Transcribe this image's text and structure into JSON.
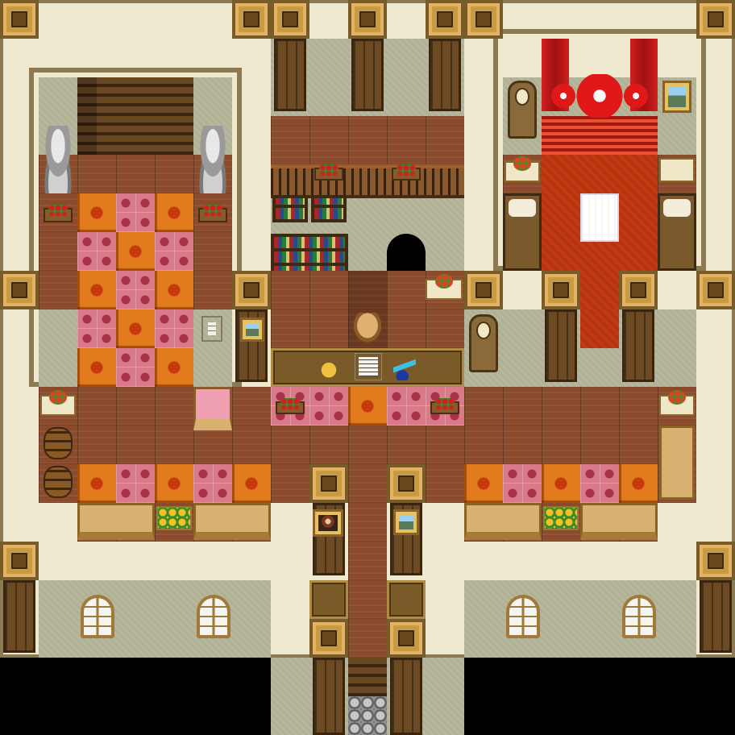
{
  "scene": {
    "map_type": "rpg-interior-top-down",
    "rooms": [
      "stair-hall",
      "library-reception",
      "bedroom",
      "left-hall",
      "right-hall",
      "entrance-corridor"
    ],
    "palette": {
      "wall": "#efe9cf",
      "trim": "#8b7a52",
      "wood_floor": "#8a4a2c",
      "rug_orange": "#e07a1c",
      "rug_pink": "#d87a8a",
      "red_carpet": "#c23a12",
      "background": "#000000"
    }
  }
}
